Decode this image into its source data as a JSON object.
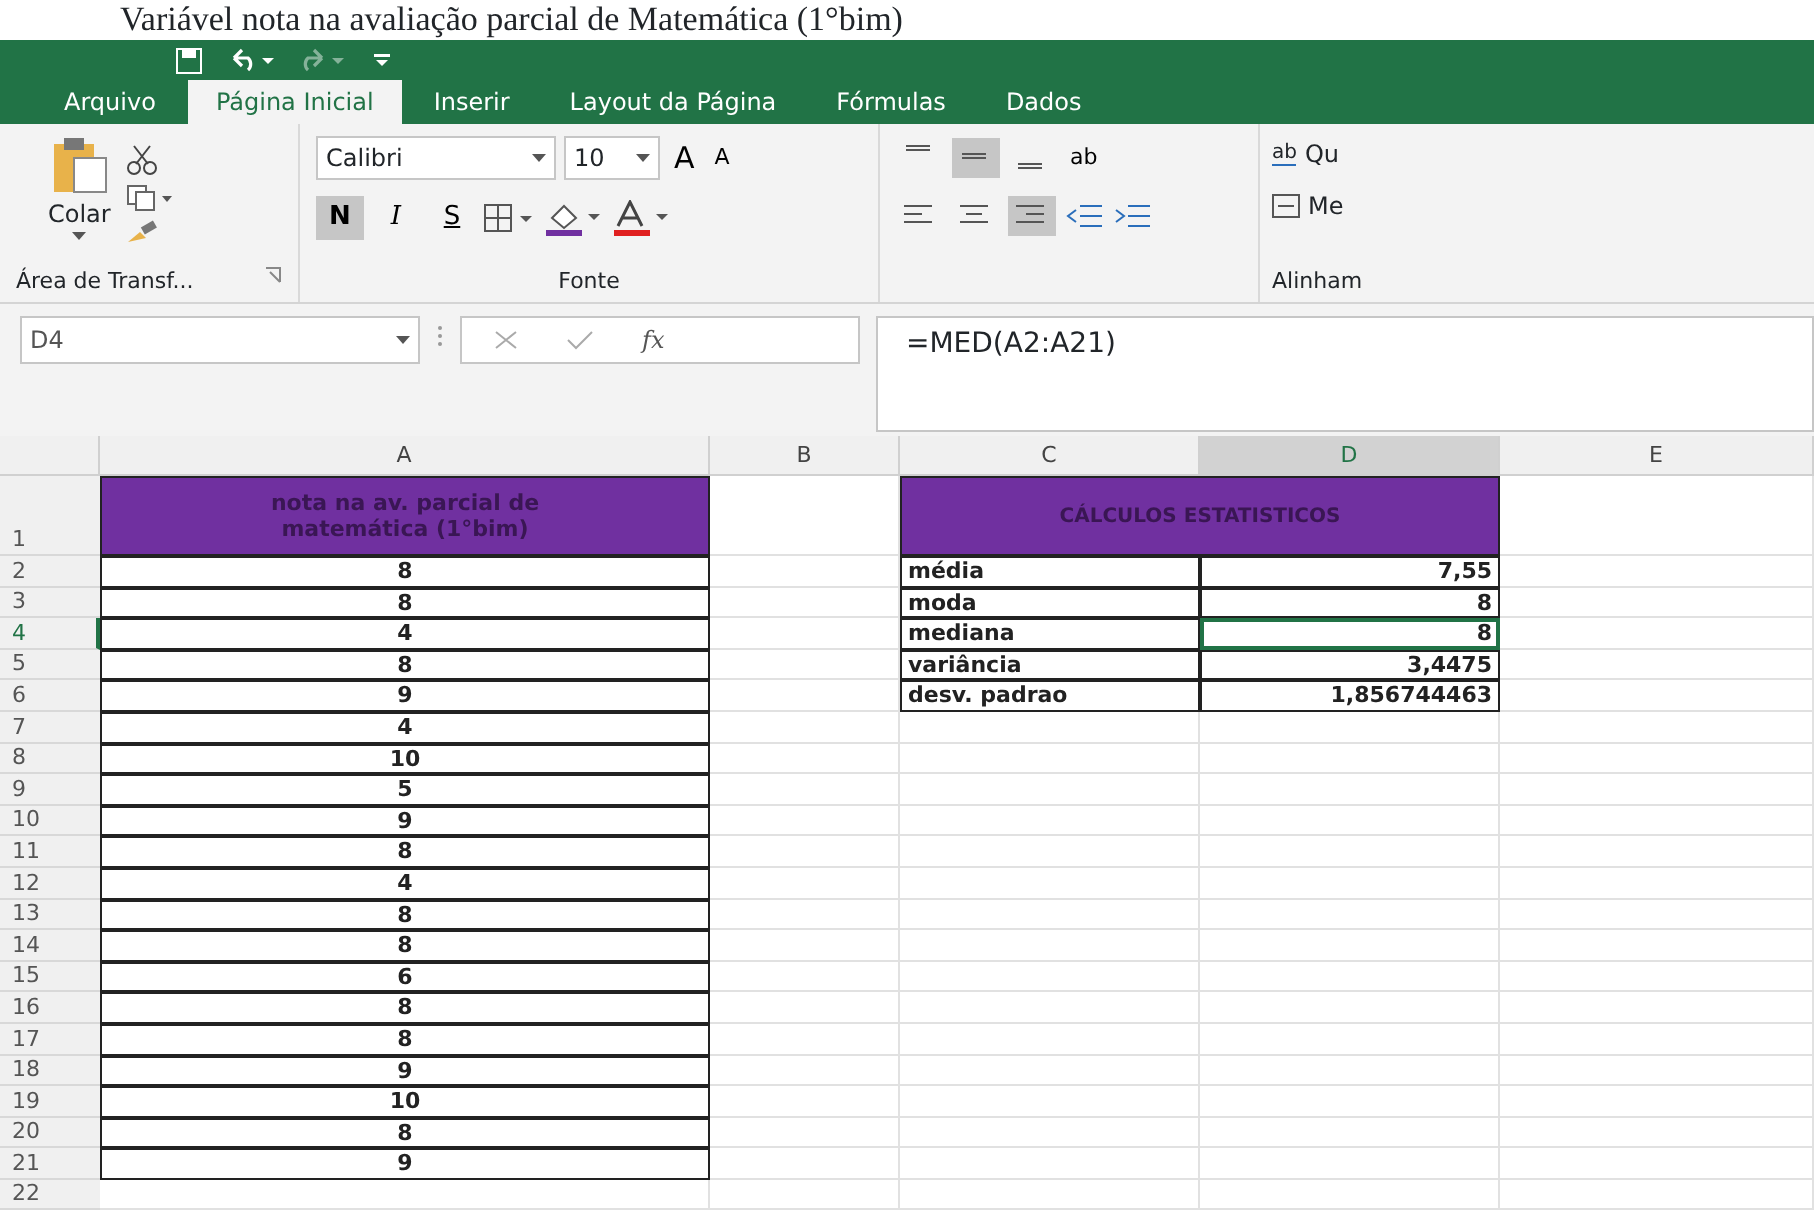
{
  "caption": "Variável nota na avaliação parcial de Matemática (1°bim)",
  "tabs": [
    {
      "label": "Arquivo",
      "selected": false
    },
    {
      "label": "Página Inicial",
      "selected": true
    },
    {
      "label": "Inserir",
      "selected": false
    },
    {
      "label": "Layout da Página",
      "selected": false
    },
    {
      "label": "Fórmulas",
      "selected": false
    },
    {
      "label": "Dados",
      "selected": false
    }
  ],
  "ribbon": {
    "clipboard": {
      "paste_label": "Colar",
      "group_label": "Área de Transf..."
    },
    "font": {
      "font_name": "Calibri",
      "font_size": "10",
      "group_label": "Fonte",
      "grow_label": "A",
      "shrink_label": "A",
      "styles": [
        {
          "kind": "bold",
          "label": "N",
          "pressed": true
        },
        {
          "kind": "italic",
          "label": "I",
          "pressed": false
        },
        {
          "kind": "underline",
          "label": "S",
          "pressed": false
        }
      ]
    },
    "alignment": {
      "group_label": "Alinham",
      "orientation_label": "ab",
      "wrap_icon": "ab",
      "wrap_label": "Qu",
      "merge_label": "Me",
      "vertical": [
        {
          "kind": "top",
          "pressed": false
        },
        {
          "kind": "middle",
          "pressed": true
        },
        {
          "kind": "bottom",
          "pressed": false
        }
      ],
      "horizontal": [
        {
          "kind": "left",
          "pressed": false
        },
        {
          "kind": "center",
          "pressed": false
        },
        {
          "kind": "right",
          "pressed": true
        }
      ]
    }
  },
  "formula_bar": {
    "name_box": "D4",
    "function_label": "fx",
    "formula": "=MED(A2:A21)"
  },
  "sheet": {
    "columns": [
      "A",
      "B",
      "C",
      "D",
      "E"
    ],
    "row_numbers": [
      "1",
      "2",
      "3",
      "4",
      "5",
      "6",
      "7",
      "8",
      "9",
      "10",
      "11",
      "12",
      "13",
      "14",
      "15",
      "16",
      "17",
      "18",
      "19",
      "20",
      "21",
      "22"
    ],
    "a_header": "nota na av. parcial de matemática (1°bim)",
    "a_values": [
      "8",
      "8",
      "4",
      "8",
      "9",
      "4",
      "10",
      "5",
      "9",
      "8",
      "4",
      "8",
      "8",
      "6",
      "8",
      "8",
      "9",
      "10",
      "8",
      "9"
    ],
    "stats": {
      "title": "CÁLCULOS ESTATISTICOS",
      "rows": [
        {
          "label": "média",
          "value": "7,55",
          "selected": false
        },
        {
          "label": "moda",
          "value": "8",
          "selected": false
        },
        {
          "label": "mediana",
          "value": "8",
          "selected": true
        },
        {
          "label": "variância",
          "value": "3,4475",
          "selected": false
        },
        {
          "label": "desv. padrao",
          "value": "1,856744463",
          "selected": false
        }
      ]
    }
  }
}
